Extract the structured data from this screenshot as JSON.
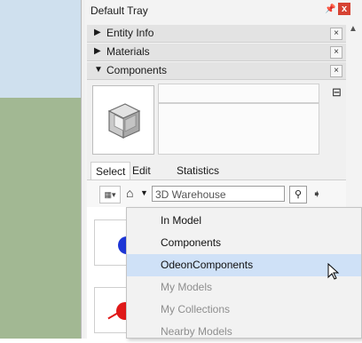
{
  "tray": {
    "title": "Default Tray",
    "pin_icon": "pin-icon",
    "close_label": "x",
    "sections": [
      {
        "label": "Entity Info",
        "expanded": false,
        "close_label": "×"
      },
      {
        "label": "Materials",
        "expanded": false,
        "close_label": "×"
      },
      {
        "label": "Components",
        "expanded": true,
        "close_label": "×"
      }
    ]
  },
  "components": {
    "tabs": [
      "Select",
      "Edit",
      "Statistics"
    ],
    "search_placeholder": "3D Warehouse",
    "search_icon": "search-icon",
    "home_icon": "house-icon",
    "dropdown_menu": [
      {
        "label": "In Model",
        "enabled": true
      },
      {
        "label": "Components",
        "enabled": true
      },
      {
        "label": "OdeonComponents",
        "enabled": true,
        "highlighted": true
      },
      {
        "label": "My Models",
        "enabled": false
      },
      {
        "label": "My Collections",
        "enabled": false
      },
      {
        "label": "Nearby Models",
        "enabled": false
      }
    ]
  },
  "colors": {
    "close_red": "#d64333",
    "highlight": "#cfe1f7",
    "ground_green": "#a2b893",
    "sky_blue": "#cfe0ee"
  }
}
